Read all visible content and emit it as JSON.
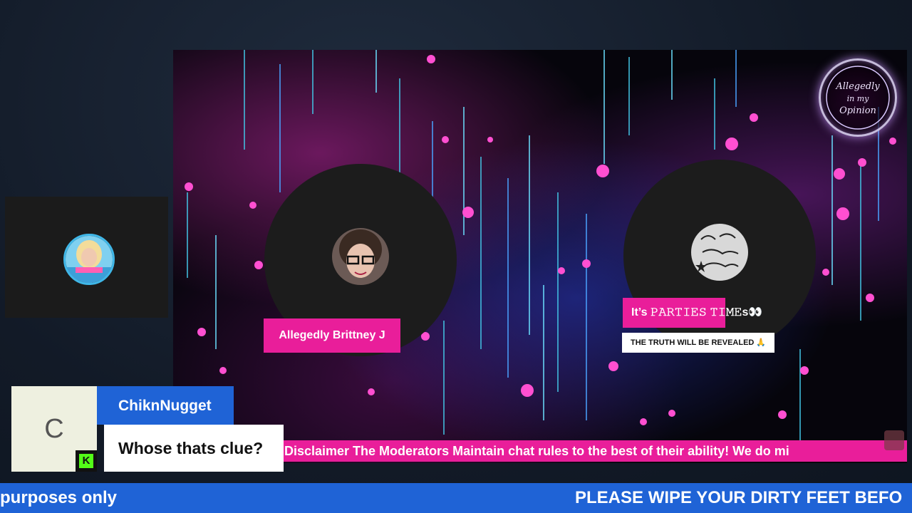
{
  "stream": {
    "logo_text": "Allegedly in my Opinion",
    "speakers": [
      {
        "name": "Allegedly Brittney J",
        "avatar": "woman-with-glasses-photo"
      },
      {
        "name": "It’s 𝙿𝙰𝚁𝚃𝙸𝙴𝚂 𝚃𝙸𝙼𝙴s👀",
        "subtitle": "THE TRUTH WILL BE REVEALED 🙏",
        "avatar": "be-the-change-handwritten-photo"
      }
    ],
    "disclaimer": "Disclaimer The Moderators Maintain chat rules to the best of their ability! We do mi",
    "corner_badge_icon": "gift-box-icon"
  },
  "webcam": {
    "avatar": "blonde-woman-beach-avatar"
  },
  "chat": {
    "avatar_letter": "C",
    "platform_badge": "K",
    "platform_badge_color": "#53fc18",
    "username": "ChiknNugget",
    "message": "Whose thats clue?"
  },
  "ticker": {
    "left_text": "purposes only",
    "right_text": "PLEASE WIPE YOUR DIRTY FEET BEFO"
  },
  "colors": {
    "accent_pink": "#e91e9a",
    "accent_blue": "#1f63d6"
  }
}
